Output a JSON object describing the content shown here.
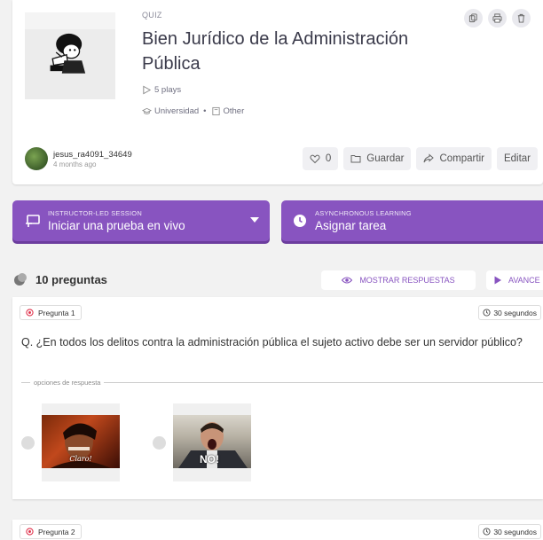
{
  "quiz": {
    "type_label": "QUIZ",
    "title": "Bien Jurídico de la Administración Pública",
    "plays": "5 plays",
    "grade": "Universidad",
    "separator": "•",
    "subject": "Other"
  },
  "author": {
    "name": "jesus_ra4091_34649",
    "time": "4 months ago"
  },
  "actions": {
    "likes": "0",
    "save": "Guardar",
    "share": "Compartir",
    "edit": "Editar"
  },
  "live": {
    "small": "INSTRUCTOR-LED SESSION",
    "big": "Iniciar una prueba en vivo"
  },
  "assign": {
    "small": "ASYNCHRONOUS LEARNING",
    "big": "Asignar tarea"
  },
  "questions_bar": {
    "count": "10 preguntas",
    "show_answers": "MOSTRAR RESPUESTAS",
    "advanced": "AVANCE"
  },
  "questions": [
    {
      "label": "Pregunta 1",
      "time": "30 segundos",
      "text": "Q. ¿En todos los delitos contra la administración pública el sujeto activo debe ser un servidor público?",
      "options_label": "opciones de respuesta",
      "options": [
        {
          "caption": "Claro!"
        },
        {
          "caption": "NO!"
        }
      ]
    },
    {
      "label": "Pregunta 2",
      "time": "30 segundos"
    }
  ],
  "colors": {
    "accent": "#8854c0",
    "badge_icon": "#e0344d"
  },
  "icons": [
    "copy-icon",
    "print-icon",
    "trash-icon",
    "play-icon",
    "graduation-cap-icon",
    "book-icon",
    "heart-icon",
    "folder-icon",
    "share-icon",
    "presentation-icon",
    "clock-icon",
    "eye-icon",
    "chevron-right-icon",
    "target-icon"
  ]
}
